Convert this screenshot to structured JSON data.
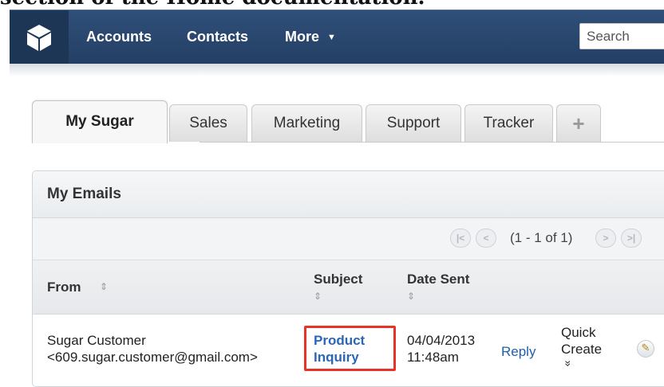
{
  "caption": "section of the Home documentation.",
  "nav": {
    "items": [
      "Accounts",
      "Contacts",
      "More"
    ],
    "search_placeholder": "Search"
  },
  "tabs": {
    "items": [
      "My Sugar",
      "Sales",
      "Marketing",
      "Support",
      "Tracker"
    ],
    "add_label": "+",
    "active": "My Sugar"
  },
  "dashlet": {
    "title": "My Emails",
    "pagination": {
      "text": "(1 - 1 of 1)"
    },
    "columns": {
      "from": "From",
      "subject": "Subject",
      "date_sent": "Date Sent"
    },
    "row": {
      "from_name": "Sugar Customer",
      "from_email": "<609.sugar.customer@gmail.com>",
      "subject_line1": "Product",
      "subject_line2": "Inquiry",
      "date": "04/04/2013",
      "time": "11:48am",
      "reply_label": "Reply",
      "quick_create_line1": "Quick",
      "quick_create_line2": "Create",
      "expand_glyph": "»"
    }
  },
  "colors": {
    "navbar": "#2a4a72",
    "logo_box": "#1d3656",
    "link": "#1f5fb0",
    "highlight": "#e8332a"
  }
}
